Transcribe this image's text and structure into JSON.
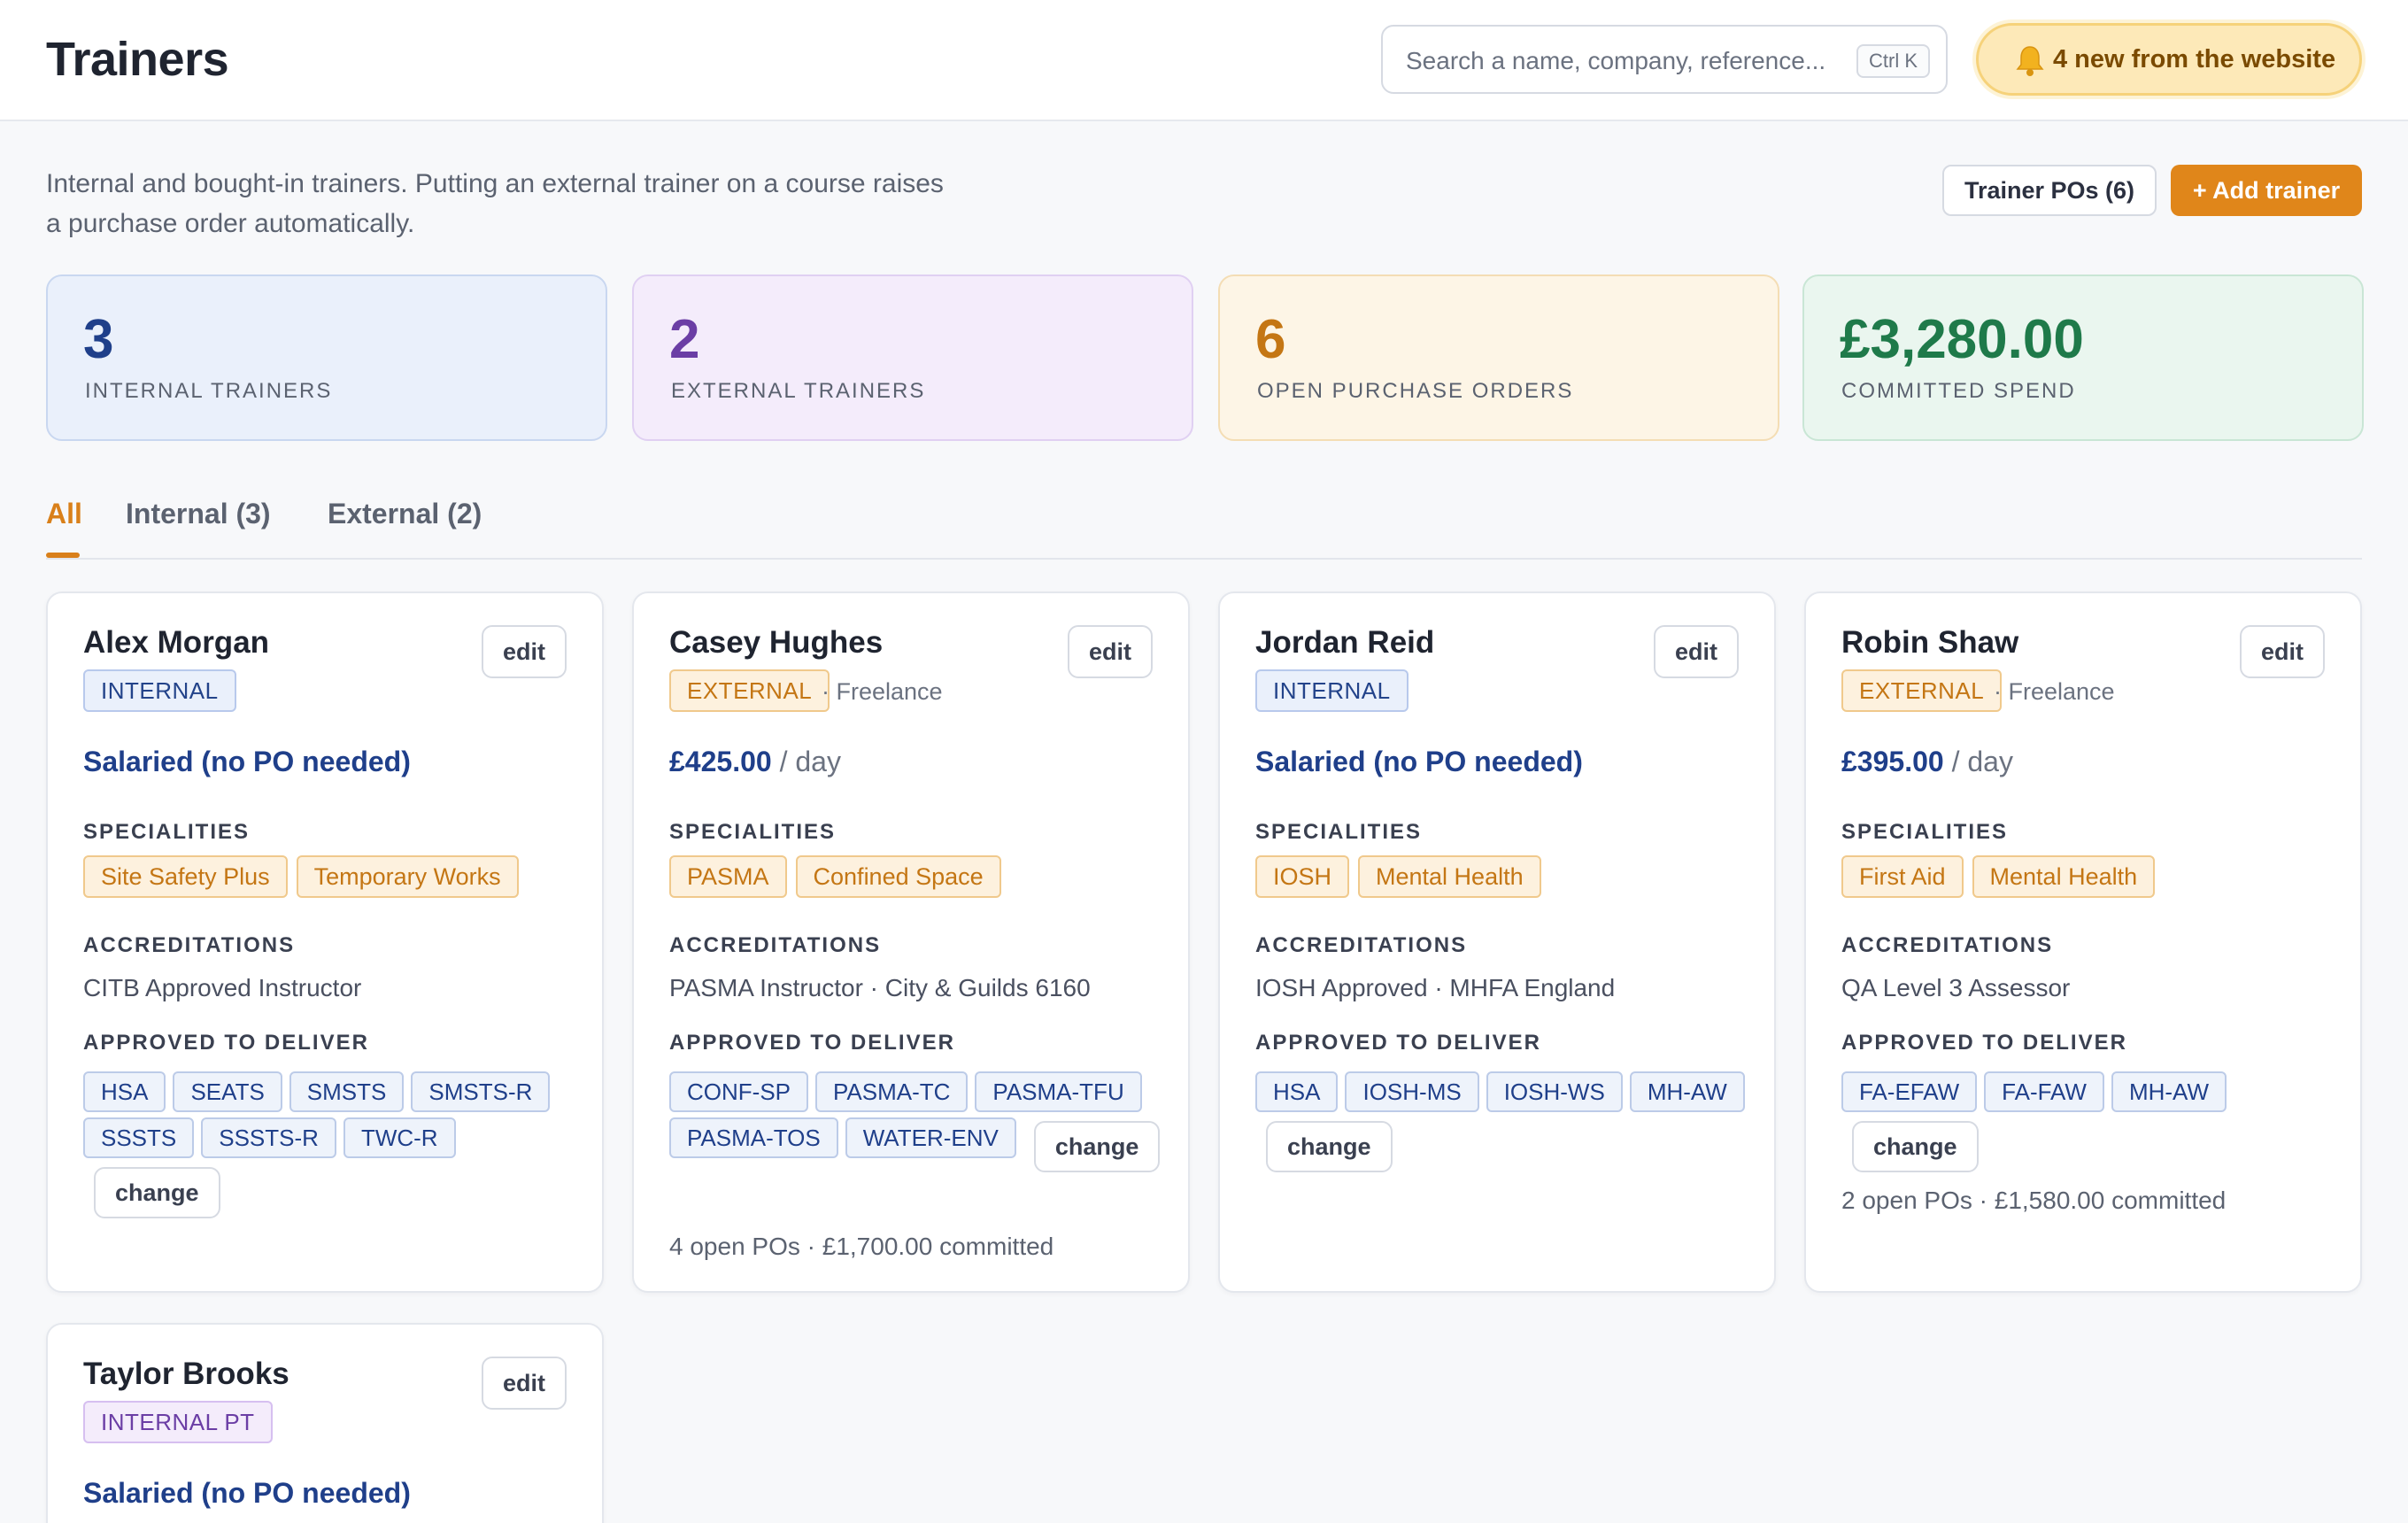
{
  "header": {
    "title": "Trainers",
    "search_placeholder": "Search a name, company, reference...",
    "search_shortcut": "Ctrl K",
    "notification": "4 new from the website"
  },
  "intro": {
    "text": "Internal and bought-in trainers. Putting an external trainer on a course raises a purchase order automatically.",
    "po_button": "Trainer POs (6)",
    "add_button": "+ Add trainer"
  },
  "stats": [
    {
      "value": "3",
      "label": "INTERNAL TRAINERS",
      "color": "#1f3f8a",
      "bg": "#eaf0fb",
      "border": "#c9d7f0"
    },
    {
      "value": "2",
      "label": "EXTERNAL TRAINERS",
      "color": "#6b3ea5",
      "bg": "#f4ecfb",
      "border": "#e0d0f2"
    },
    {
      "value": "6",
      "label": "OPEN PURCHASE ORDERS",
      "color": "#c47614",
      "bg": "#fdf5e6",
      "border": "#f4ddb4"
    },
    {
      "value": "£3,280.00",
      "label": "COMMITTED SPEND",
      "color": "#1f7a4a",
      "bg": "#eaf6ef",
      "border": "#c9e6d5"
    }
  ],
  "tabs": [
    "All",
    "Internal (3)",
    "External (2)"
  ],
  "labels": {
    "specialities": "SPECIALITIES",
    "accreditations": "ACCREDITATIONS",
    "approved": "APPROVED TO DELIVER",
    "edit": "edit",
    "change": "change",
    "per_day": "/ day"
  },
  "trainers": [
    {
      "name": "Alex Morgan",
      "type": "INTERNAL",
      "rate": "Salaried (no PO needed)",
      "specialities": [
        "Site Safety Plus",
        "Temporary Works"
      ],
      "accreditations": "CITB Approved Instructor",
      "courses": [
        "HSA",
        "SEATS",
        "SMSTS",
        "SMSTS-R",
        "SSSTS",
        "SSSTS-R",
        "TWC-R"
      ]
    },
    {
      "name": "Casey Hughes",
      "type": "EXTERNAL",
      "company": "· Freelance",
      "rate": "£425.00",
      "specialities": [
        "PASMA",
        "Confined Space"
      ],
      "accreditations": "PASMA Instructor · City & Guilds 6160",
      "courses": [
        "CONF-SP",
        "PASMA-TC",
        "PASMA-TFU",
        "PASMA-TOS",
        "WATER-ENV"
      ],
      "po_summary": "4 open POs · £1,700.00 committed"
    },
    {
      "name": "Jordan Reid",
      "type": "INTERNAL",
      "rate": "Salaried (no PO needed)",
      "specialities": [
        "IOSH",
        "Mental Health"
      ],
      "accreditations": "IOSH Approved · MHFA England",
      "courses": [
        "HSA",
        "IOSH-MS",
        "IOSH-WS",
        "MH-AW"
      ]
    },
    {
      "name": "Robin Shaw",
      "type": "EXTERNAL",
      "company": "· Freelance",
      "rate": "£395.00",
      "specialities": [
        "First Aid",
        "Mental Health"
      ],
      "accreditations": "QA Level 3 Assessor",
      "courses": [
        "FA-EFAW",
        "FA-FAW",
        "MH-AW"
      ],
      "po_summary": "2 open POs · £1,580.00 committed"
    },
    {
      "name": "Taylor Brooks",
      "type": "INTERNAL PT",
      "rate": "Salaried (no PO needed)"
    }
  ]
}
